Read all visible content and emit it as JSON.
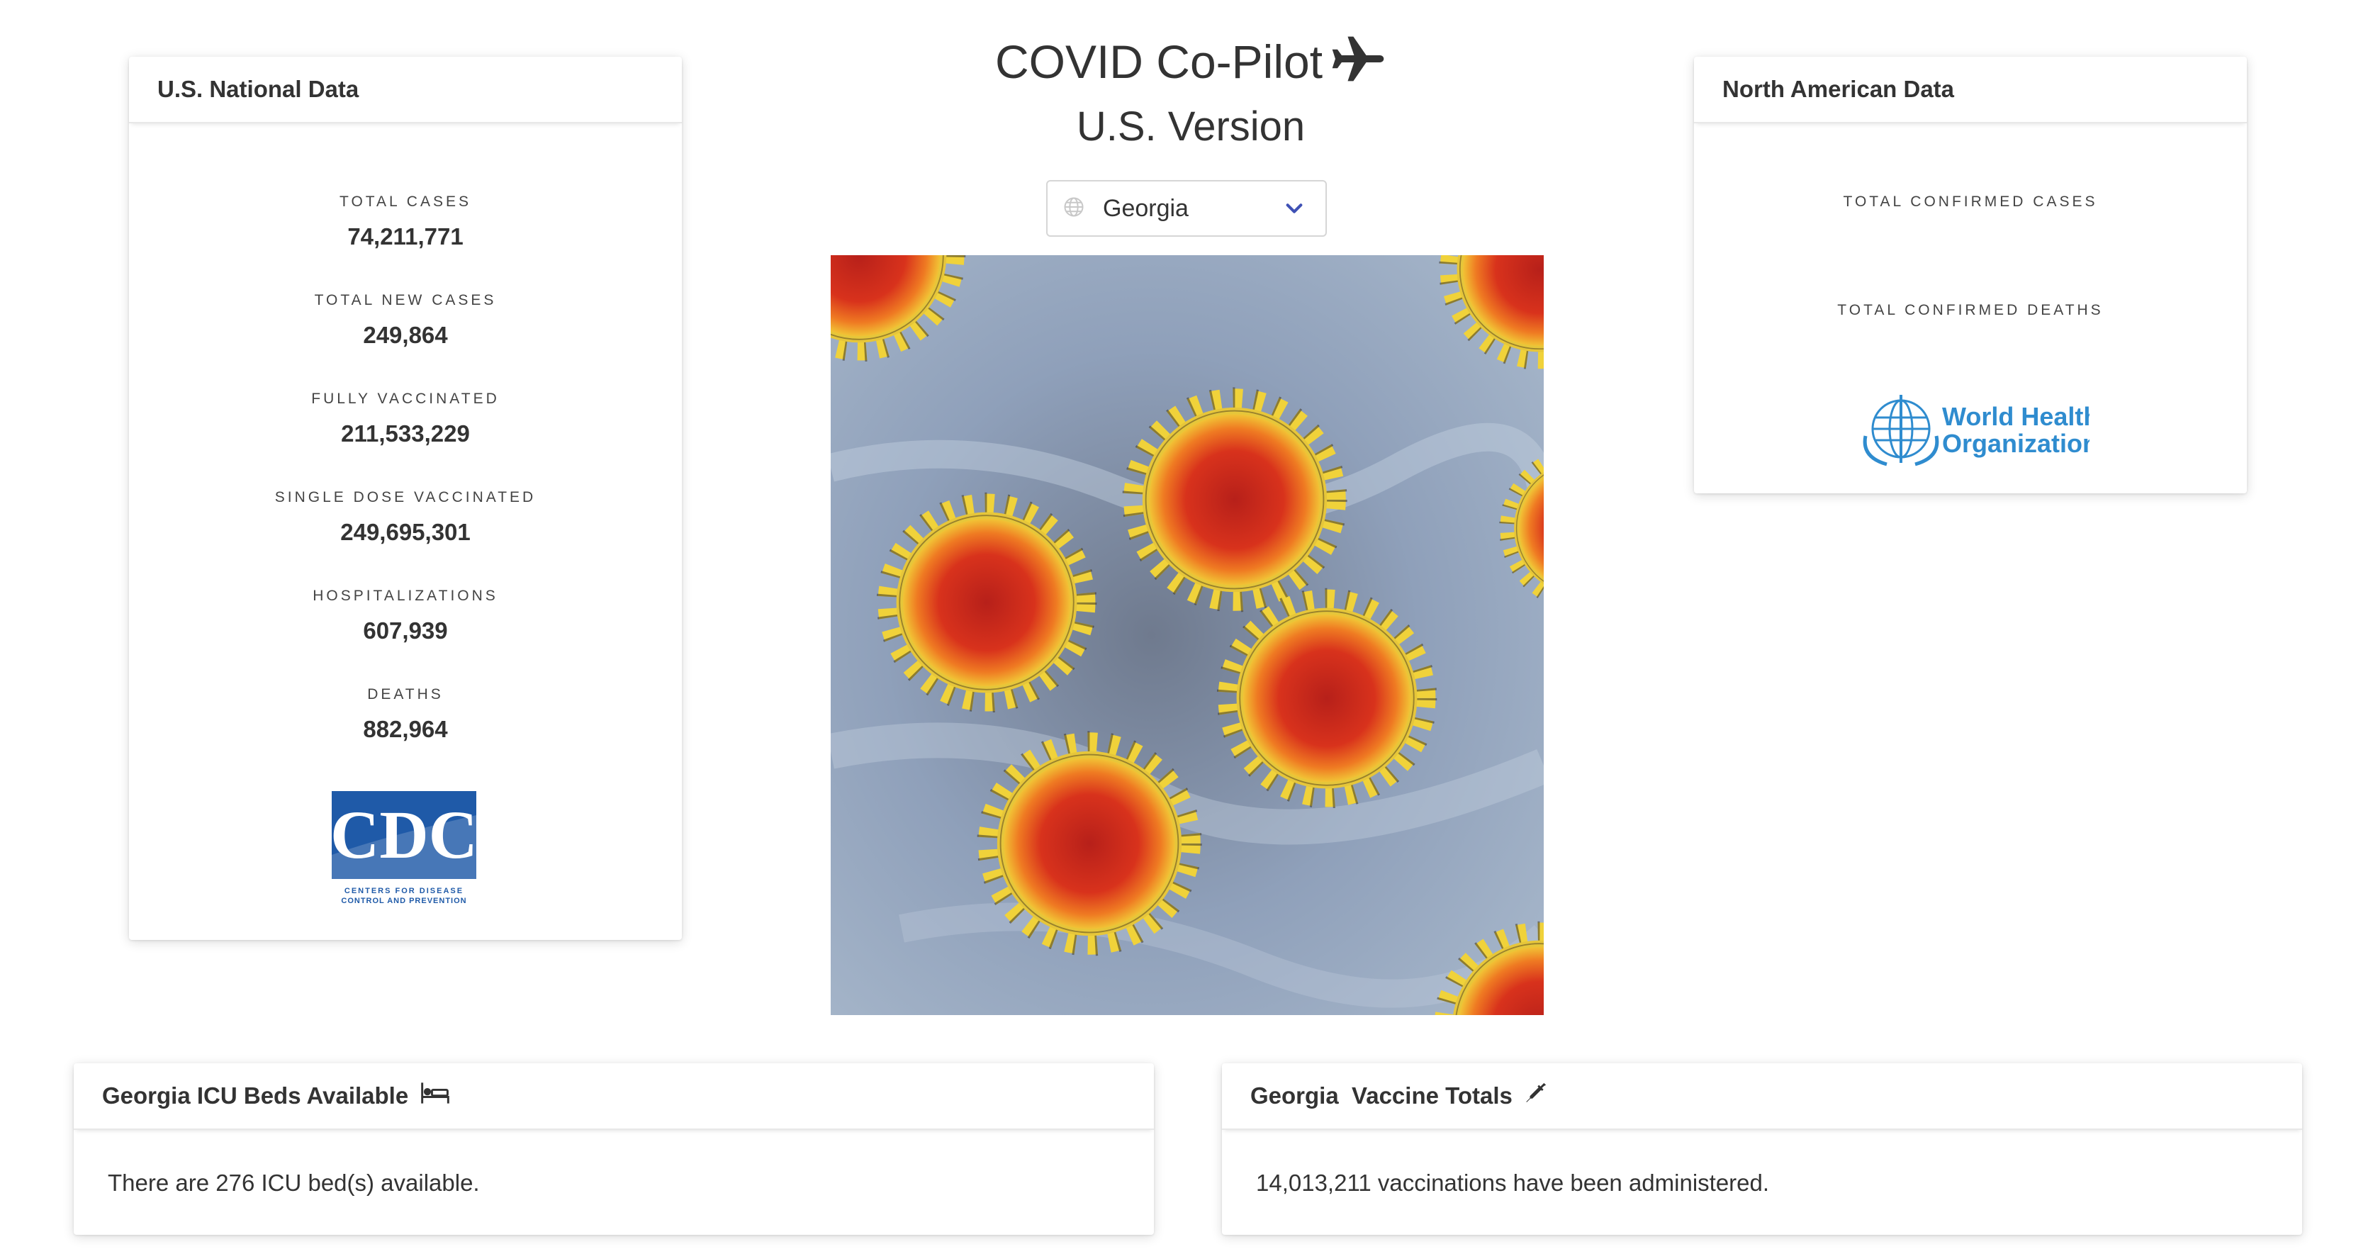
{
  "app": {
    "title": "COVID Co-Pilot",
    "subtitle": "U.S. Version",
    "plane_icon": "airplane-icon"
  },
  "state_select": {
    "value": "Georgia",
    "globe_icon": "globe-icon",
    "chevron_icon": "chevron-down-icon",
    "chevron_color": "#3f51b5"
  },
  "us_card": {
    "title": "U.S. National Data",
    "stats": [
      {
        "label": "TOTAL CASES",
        "value": "74,211,771"
      },
      {
        "label": "TOTAL NEW CASES",
        "value": "249,864"
      },
      {
        "label": "FULLY VACCINATED",
        "value": "211,533,229"
      },
      {
        "label": "SINGLE DOSE VACCINATED",
        "value": "249,695,301"
      },
      {
        "label": "HOSPITALIZATIONS",
        "value": "607,939"
      },
      {
        "label": "DEATHS",
        "value": "882,964"
      }
    ],
    "logo": {
      "text": "CDC",
      "caption1": "CENTERS FOR DISEASE",
      "caption2": "CONTROL AND PREVENTION",
      "color": "#1f5aa8"
    }
  },
  "na_card": {
    "title": "North American Data",
    "stats": [
      {
        "label": "TOTAL CONFIRMED CASES",
        "value": ""
      },
      {
        "label": "TOTAL CONFIRMED DEATHS",
        "value": ""
      }
    ],
    "logo": {
      "line1": "World Health",
      "line2": "Organization",
      "color": "#2f8ccf"
    }
  },
  "icu_card": {
    "title": "Georgia ICU Beds Available",
    "icon": "bed-icon",
    "text": "There are 276 ICU bed(s) available."
  },
  "vax_card": {
    "title": "Georgia  Vaccine Totals",
    "icon": "syringe-icon",
    "text": "14,013,211 vaccinations have been administered."
  },
  "colors": {
    "virus_core": "#d8321c",
    "virus_ring": "#f2d43a",
    "virus_background": "#8e9fb8"
  }
}
